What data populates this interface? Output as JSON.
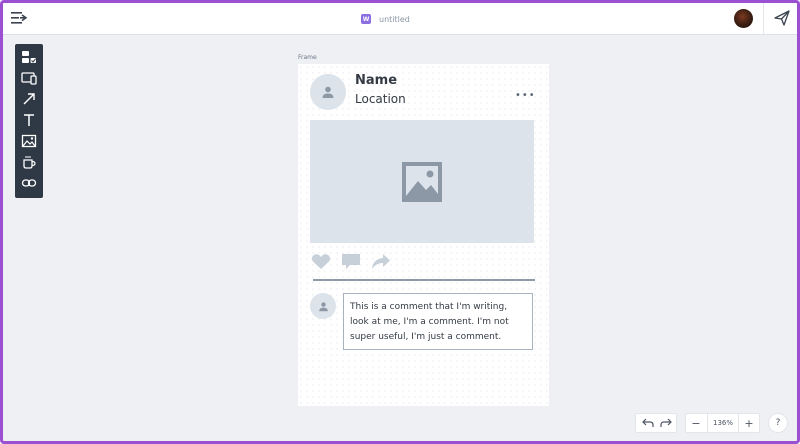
{
  "app": {
    "doc_badge": "W",
    "doc_title": "untitled"
  },
  "icons": {
    "menu": "menu-collapse-icon",
    "send": "send-icon",
    "avatar": "user-avatar"
  },
  "toolbox": {
    "tools": [
      "components-icon",
      "device-icon",
      "arrow-icon",
      "text-icon",
      "image-icon",
      "coffee-icon",
      "link-icon"
    ]
  },
  "canvas": {
    "frame_label": "Frame",
    "post": {
      "name": "Name",
      "location": "Location",
      "more": "•••",
      "actions": [
        "heart-icon",
        "comment-icon",
        "share-icon"
      ],
      "comment_lines": [
        "This is a comment that I'm writing,",
        "look at me, I'm a comment. I'm not",
        "super useful, I'm just a comment."
      ]
    }
  },
  "footer": {
    "zoom_minus": "−",
    "zoom": "136%",
    "zoom_plus": "+",
    "help": "?"
  },
  "colors": {
    "accent_border": "#9b4fd1",
    "doc_icon": "#8b6fe0",
    "toolbox_bg": "#2f3946",
    "placeholder": "#dde3ea"
  }
}
